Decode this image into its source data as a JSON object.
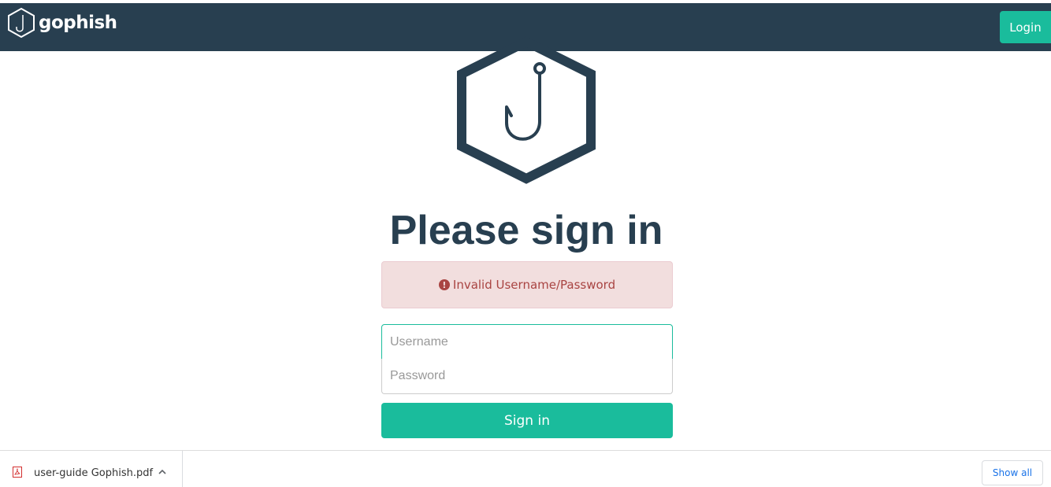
{
  "navbar": {
    "brand": "gophish",
    "login_label": "Login"
  },
  "page": {
    "heading": "Please sign in",
    "alert_text": "Invalid Username/Password",
    "username_placeholder": "Username",
    "password_placeholder": "Password",
    "signin_label": "Sign in"
  },
  "download_bar": {
    "file_name": "user-guide Gophish.pdf",
    "show_all_label": "Show all"
  },
  "icons": {
    "brand": "gophish-hook-logo-icon",
    "hero": "gophish-hook-logo-icon",
    "alert": "exclamation-circle-icon",
    "file": "pdf-file-icon",
    "chevron": "chevron-up-icon"
  },
  "colors": {
    "navbar": "#283f50",
    "accent": "#1abc9c",
    "alert_bg": "#f2dede",
    "alert_text": "#a94442"
  }
}
